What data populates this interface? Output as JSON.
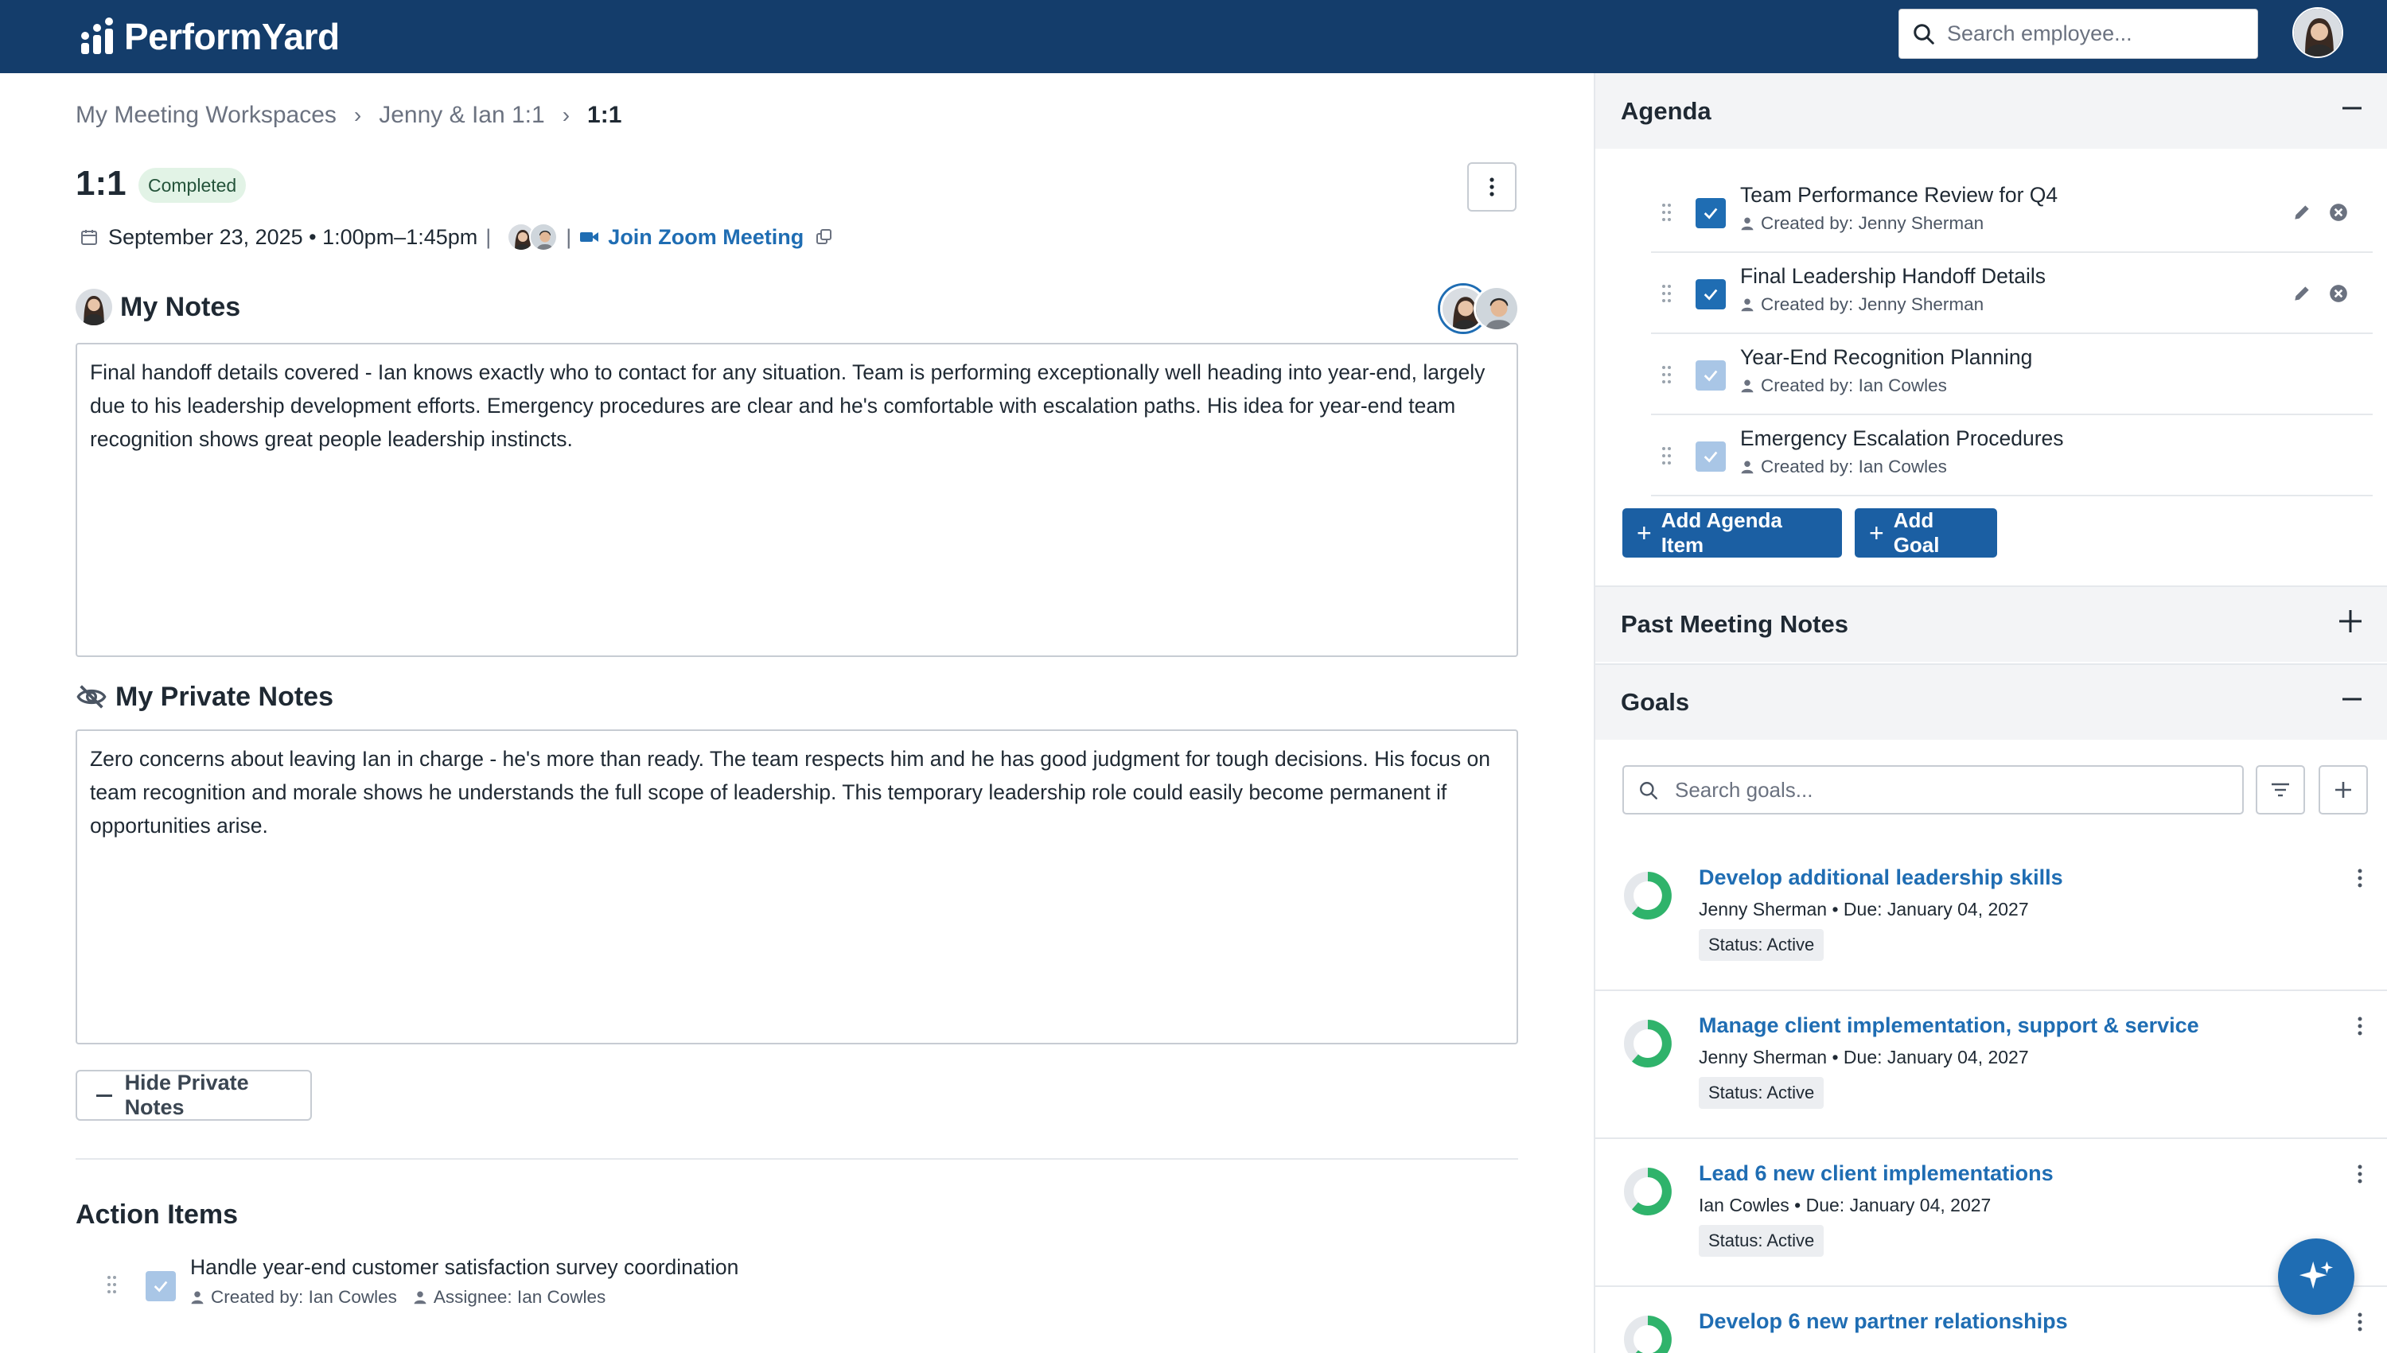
{
  "brand": {
    "name": "PerformYard"
  },
  "header": {
    "search_placeholder": "Search employee..."
  },
  "breadcrumb": [
    "My Meeting Workspaces",
    "Jenny & Ian 1:1",
    "1:1"
  ],
  "meeting": {
    "title": "1:1",
    "status": "Completed",
    "date": "September 23, 2025 • 1:00pm–1:45pm",
    "zoom_label": "Join Zoom Meeting"
  },
  "my_notes": {
    "heading": "My Notes",
    "text": "Final handoff details covered - Ian knows exactly who to contact for any situation. Team is performing exceptionally well heading into year-end, largely due to his leadership development efforts. Emergency procedures are clear and he's comfortable with escalation paths. His idea for year-end team recognition shows great people leadership instincts."
  },
  "private_notes": {
    "heading": "My Private Notes",
    "text": "Zero concerns about leaving Ian in charge - he's more than ready. The team respects him and he has good judgment for tough decisions. His focus on team recognition and morale shows he understands the full scope of leadership. This temporary leadership role could easily become permanent if opportunities arise.",
    "hide_label": "Hide Private Notes"
  },
  "action_items": {
    "heading": "Action Items",
    "items": [
      {
        "title": "Handle year-end customer satisfaction survey coordination",
        "created_by": "Created by: Ian Cowles",
        "assignee": "Assignee: Ian Cowles"
      }
    ]
  },
  "agenda": {
    "heading": "Agenda",
    "items": [
      {
        "title": "Team Performance Review for Q4",
        "created_by": "Created by: Jenny Sherman",
        "state": "checked"
      },
      {
        "title": "Final Leadership Handoff Details",
        "created_by": "Created by: Jenny Sherman",
        "state": "checked"
      },
      {
        "title": "Year-End Recognition Planning",
        "created_by": "Created by: Ian Cowles",
        "state": "checked-disabled"
      },
      {
        "title": "Emergency Escalation Procedures",
        "created_by": "Created by: Ian Cowles",
        "state": "checked-disabled"
      }
    ],
    "add_item_label": "Add Agenda Item",
    "add_goal_label": "Add Goal"
  },
  "past_notes": {
    "heading": "Past Meeting Notes"
  },
  "goals": {
    "heading": "Goals",
    "search_placeholder": "Search goals...",
    "items": [
      {
        "title": "Develop additional leadership skills",
        "meta": "Jenny Sherman  •  Due: January 04, 2027",
        "status": "Status: Active"
      },
      {
        "title": "Manage client implementation, support & service",
        "meta": "Jenny Sherman  •  Due: January 04, 2027",
        "status": "Status: Active"
      },
      {
        "title": "Lead 6 new client implementations",
        "meta": "Ian Cowles  •  Due: January 04, 2027",
        "status": "Status: Active"
      },
      {
        "title": "Develop 6 new partner relationships",
        "meta": "",
        "status": ""
      }
    ]
  },
  "colors": {
    "header_bg": "#143d6b",
    "accent": "#1f6db3",
    "goal_ring": "#2fb36b",
    "badge_bg": "#e2f3e6"
  }
}
